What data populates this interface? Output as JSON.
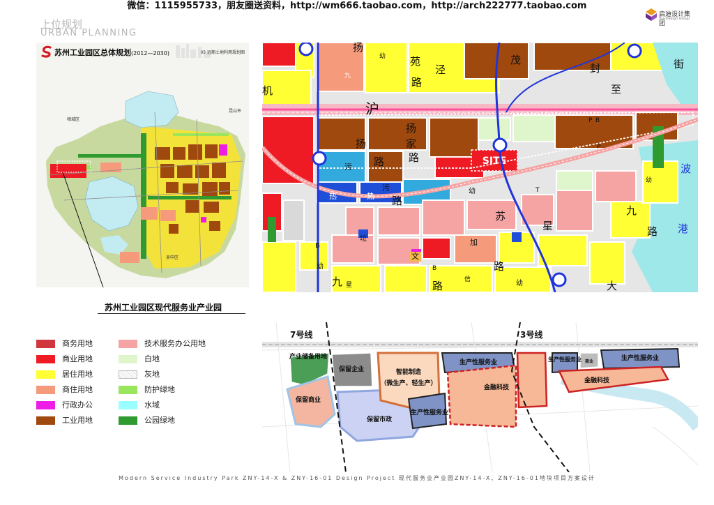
{
  "banner": {
    "text": "微信：1115955733，朋友圈送资料，http://wm666.taobao.com，http://arch222777.taobao.com"
  },
  "brand": {
    "name": "启迪设计集团",
    "sub": "Tus-Design Group",
    "colors": {
      "mark_purple": "#6a2b8c",
      "mark_orange": "#e89a1c"
    }
  },
  "section": {
    "title_cn": "上位规划",
    "title_en": "URBAN PLANNING"
  },
  "overview_map": {
    "title": "苏州工业园区总体规划",
    "years": "(2012—2030)",
    "subtitle": "05 远期土地利用规划图",
    "district_labels": [
      "相城区",
      "昆山市",
      "吴中区"
    ]
  },
  "caption": "苏州工业园区现代服务业产业园",
  "legend": [
    {
      "label": "商务用地",
      "color": "#d0363c"
    },
    {
      "label": "商业用地",
      "color": "#ee1b24"
    },
    {
      "label": "居住用地",
      "color": "#ffff33"
    },
    {
      "label": "商住用地",
      "color": "#f59b7c"
    },
    {
      "label": "行政办公",
      "color": "#ee1de6"
    },
    {
      "label": "工业用地",
      "color": "#a0490e"
    },
    {
      "label": "技术服务办公用地",
      "color": "#f6a3a3"
    },
    {
      "label": "白地",
      "color": "#dff5cc"
    },
    {
      "label": "灰地",
      "color": "#d9d9d9"
    },
    {
      "label": "防护绿地",
      "color": "#99e65c"
    },
    {
      "label": "水域",
      "color": "#99ffff"
    },
    {
      "label": "公园绿地",
      "color": "#2f9a2f"
    }
  ],
  "detail_map": {
    "site_label": "SITE",
    "char_labels": [
      "扬",
      "幼",
      "苑",
      "泾",
      "路",
      "茂",
      "封",
      "至",
      "街",
      "机",
      "九",
      "沪",
      "扬",
      "路",
      "扬",
      "家",
      "路",
      "P",
      "B",
      "污",
      "热",
      "污",
      "热",
      "路",
      "幼",
      "P",
      "幼",
      "九",
      "苏",
      "星",
      "路",
      "港",
      "T",
      "B",
      "垃",
      "加",
      "文",
      "B",
      "幼",
      "路",
      "幼",
      "九",
      "星",
      "信",
      "大",
      "路",
      "波"
    ]
  },
  "zoning_plan": {
    "lines": [
      "7号线",
      "3号线"
    ],
    "zones": [
      "产业储备用地",
      "保留企业",
      "智能制造",
      "（微生产、轻生产）",
      "生产性服务业",
      "保留商业",
      "保留市政",
      "生产性服务业",
      "金融科技",
      "生产性服务业",
      "生产性服务业",
      "金融科技",
      "商业"
    ]
  },
  "footer": {
    "text": "Modern Service Industry Park ZNY-14-X & ZNY-16-01 Design Project  现代服务业产业园ZNY-14-X、ZNY-16-01地块项目方案设计"
  }
}
